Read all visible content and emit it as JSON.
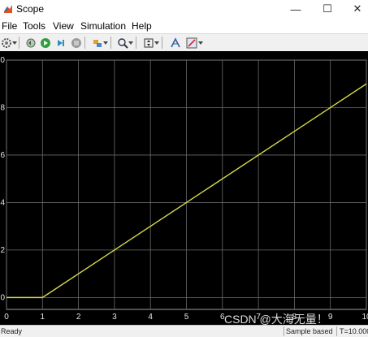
{
  "window": {
    "title": "Scope",
    "controls": [
      "minimize-icon",
      "maximize-icon",
      "close-icon"
    ]
  },
  "menu": [
    "File",
    "Tools",
    "View",
    "Simulation",
    "Help"
  ],
  "toolbar": {
    "icons": [
      "settings-icon",
      "restore-icon",
      "run-icon",
      "step-forward-icon",
      "stop-icon",
      "highlight-icon",
      "zoom-icon",
      "autoscale-icon",
      "cursor-measure-icon",
      "style-icon"
    ]
  },
  "chart_data": {
    "type": "line",
    "background": "#000000",
    "line_color": "#d8d84a",
    "grid": true,
    "xlim": [
      0,
      10
    ],
    "ylim": [
      -0.5,
      10
    ],
    "x_ticks": [
      "0",
      "1",
      "2",
      "3",
      "4",
      "5",
      "6",
      "7",
      "8",
      "9",
      "10"
    ],
    "y_ticks": [
      "0",
      "2",
      "4",
      "6",
      "8",
      "10"
    ],
    "series": [
      {
        "x": [
          0,
          1,
          10
        ],
        "y": [
          0,
          0,
          9
        ]
      }
    ]
  },
  "status": {
    "ready": "Ready",
    "sample": "Sample based",
    "time": "T=10.000"
  },
  "watermark": "CSDN @大海无量！"
}
